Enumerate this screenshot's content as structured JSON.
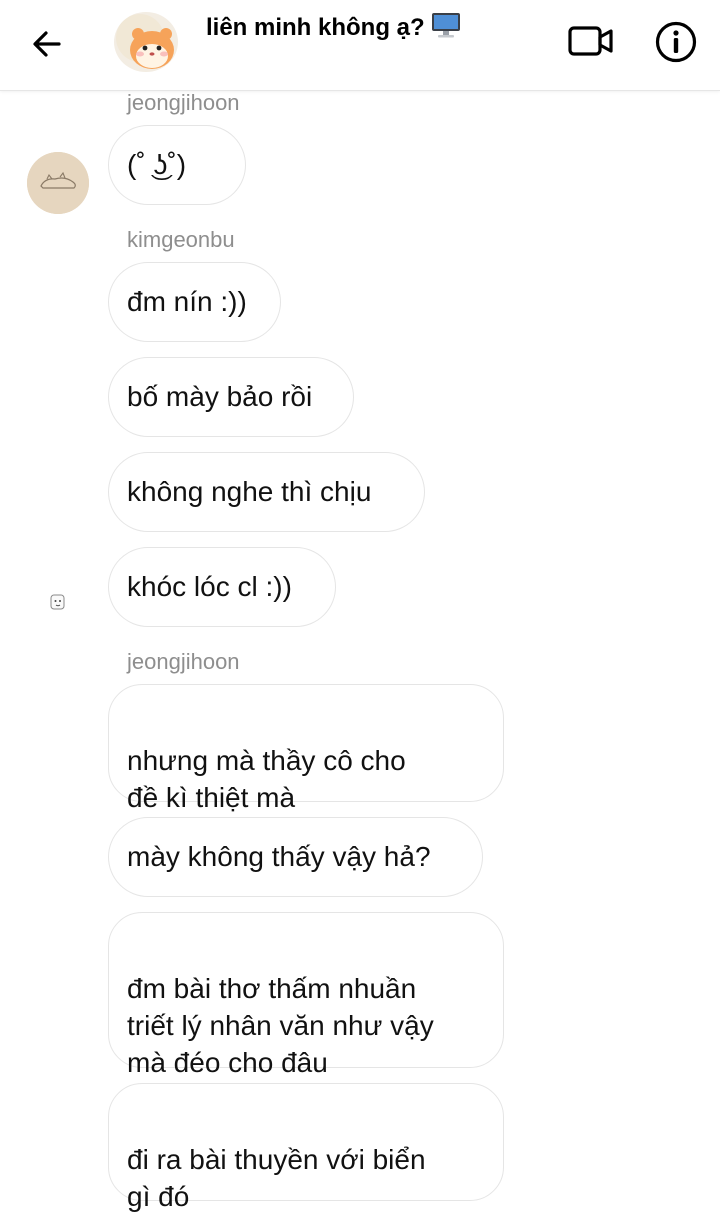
{
  "header": {
    "title": "liên minh không ạ?",
    "title_emoji_icon": "desktop-computer-icon",
    "back_icon": "arrow-left-icon",
    "video_icon": "video-camera-icon",
    "info_icon": "info-icon"
  },
  "messages": [
    {
      "sender": "jeongjihoon",
      "bubbles": [
        "(˚ ͜ʖ˚)"
      ]
    },
    {
      "sender": "kimgeonbu",
      "bubbles": [
        "đm nín :))",
        "bố mày bảo rồi",
        "không nghe thì chịu",
        "khóc lóc cl :))"
      ]
    },
    {
      "sender": "jeongjihoon",
      "bubbles": [
        "nhưng mà thầy cô cho\nđề kì thiệt mà",
        "mày không thấy vậy hả?",
        "đm bài thơ thấm nhuần\ntriết lý nhân văn như vậy\nmà đéo cho đâu",
        "đi ra bài thuyền với biển\ngì đó"
      ]
    }
  ],
  "colors": {
    "sender_name": "#8e8e8e",
    "bubble_border": "#e5e5e5",
    "avatar_bg": "#e6d6bf"
  }
}
